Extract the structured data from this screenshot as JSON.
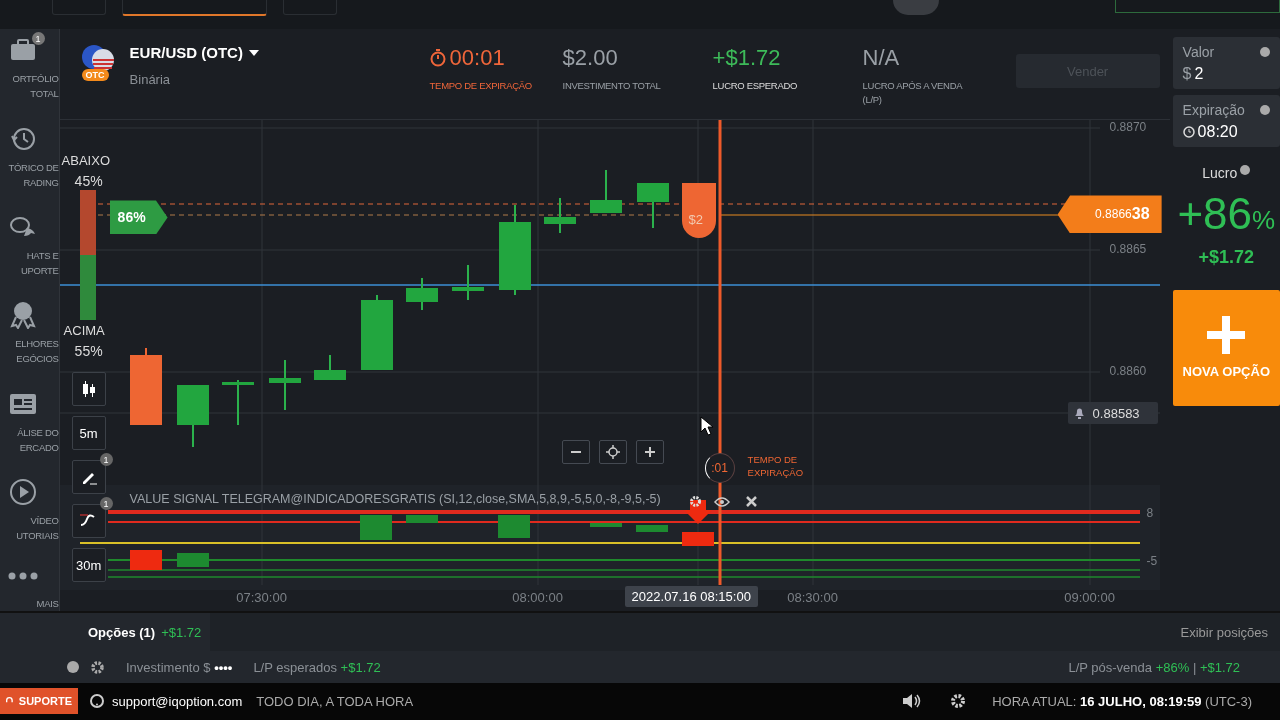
{
  "sidebar": {
    "items": [
      {
        "label": "ORTFÓLIO TOTAL",
        "badge": "1"
      },
      {
        "label": "TÓRICO DE RADING"
      },
      {
        "label": "HATS E UPORTE"
      },
      {
        "label": "ELHORES EGÓCIOS"
      },
      {
        "label": "ÁLISE DO ERCADO"
      },
      {
        "label": "VÍDEO UTORIAIS"
      },
      {
        "label": "MAIS"
      }
    ]
  },
  "asset": {
    "name": "EUR/USD (OTC)",
    "badge": "OTC",
    "type": "Binária"
  },
  "header_stats": [
    {
      "kind": "timer",
      "value": "00:01",
      "label": "TEMPO DE EXPIRAÇÃO"
    },
    {
      "kind": "plain",
      "value": "$2.00",
      "label": "INVESTIMENTO TOTAL"
    },
    {
      "kind": "profit",
      "value": "+$1.72",
      "label": "LUCRO ESPERADO"
    },
    {
      "kind": "plain",
      "value": "N/A",
      "label": "LUCRO APÓS A VENDA (L/P)"
    }
  ],
  "sell_button": {
    "label": "Vender",
    "disabled": true
  },
  "chart": {
    "price_ticks": [
      "0.8870",
      "0.8865",
      "0.8860"
    ],
    "time_ticks": [
      "07:30:00",
      "08:00:00",
      "08:30:00",
      "09:00:00"
    ],
    "cursor_time": "2022.07.16 08:15:00",
    "down_label": "ABAIXO",
    "down_pct": "45%",
    "up_label": "ACIMA",
    "up_pct": "55%",
    "payout_tag": "86%",
    "trade_amount": "$2",
    "current_price": "0.8866**38**",
    "alert_price": "0.88583",
    "expiry_countdown": ":01",
    "expiry_label": "TEMPO DE EXPIRAÇÃO",
    "tools": [
      {
        "kind": "candles"
      },
      {
        "kind": "text",
        "label": "5m"
      },
      {
        "kind": "pencil",
        "badge": "1"
      },
      {
        "kind": "indicator",
        "badge": "1"
      },
      {
        "kind": "text",
        "label": "30m"
      }
    ],
    "indicator": {
      "label": "VALUE SIGNAL TELEGRAM@INDICADORESGRATIS (SI,12,close,SMA,5,8,9,-5,5,0,-8,-9,5,-5)",
      "ticks": [
        "8",
        "-5"
      ]
    }
  },
  "right_panel": {
    "amount": {
      "label": "Valor",
      "currency": "$",
      "value": "2"
    },
    "expiry": {
      "label": "Expiração",
      "value": "08:20"
    },
    "profit": {
      "label": "Lucro",
      "percent": "+86",
      "percent_sign": "%",
      "amount": "+$1.72"
    },
    "new_option": {
      "label": "NOVA OPÇÃO"
    }
  },
  "options_bar": {
    "tab": "Opções (1)",
    "tab_profit": "+$1.72",
    "show_positions": "Exibir posições"
  },
  "summary": {
    "investment_label": "Investimento $",
    "investment_value": "••••",
    "expected_label": "L/P esperados",
    "expected_value": "+$1.72",
    "post_sale_label": "L/P pós-venda",
    "post_sale_pct": "+86%",
    "post_sale_separator": "|",
    "post_sale_value": "+$1.72"
  },
  "footer": {
    "support_button": "SUPORTE",
    "email": "support@iqoption.com",
    "hours": "TODO DIA, A TODA HORA",
    "clock_label": "HORA ATUAL:",
    "clock_value": "16 JULHO, 08:19:59",
    "timezone": "(UTC-3)"
  }
}
